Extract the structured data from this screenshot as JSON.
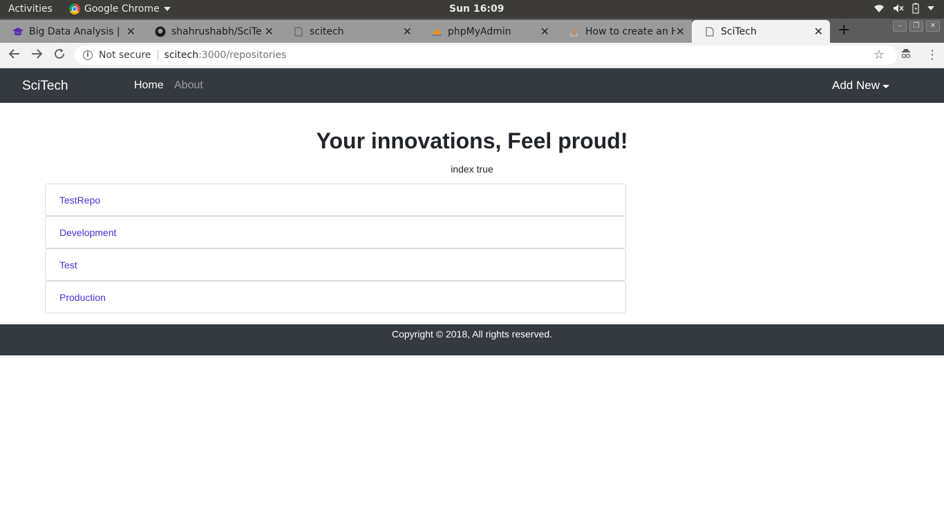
{
  "desktop": {
    "activities": "Activities",
    "app_name": "Google Chrome",
    "clock": "Sun 16:09"
  },
  "browser": {
    "tabs": [
      {
        "label": "Big Data Analysis | F",
        "icon": "graduation-cap-icon"
      },
      {
        "label": "shahrushabh/SciTec",
        "icon": "github-icon"
      },
      {
        "label": "scitech",
        "icon": "document-icon"
      },
      {
        "label": "phpMyAdmin",
        "icon": "phpmyadmin-icon"
      },
      {
        "label": "How to create an HT",
        "icon": "stackoverflow-icon"
      },
      {
        "label": "SciTech",
        "icon": "document-icon"
      }
    ],
    "active_tab_index": 5,
    "security_label": "Not secure",
    "url_host": "scitech",
    "url_path": ":3000/repositories"
  },
  "navbar": {
    "brand": "SciTech",
    "links": [
      "Home",
      "About"
    ],
    "dropdown_label": "Add New"
  },
  "main": {
    "heading": "Your innovations, Feel proud!",
    "subtext": "index true",
    "repositories": [
      "TestRepo",
      "Development",
      "Test",
      "Production"
    ]
  },
  "footer": {
    "text": "Copyright © 2018, All rights reserved."
  },
  "colors": {
    "navbar_bg": "#343a40",
    "link": "#4b2fd9"
  }
}
